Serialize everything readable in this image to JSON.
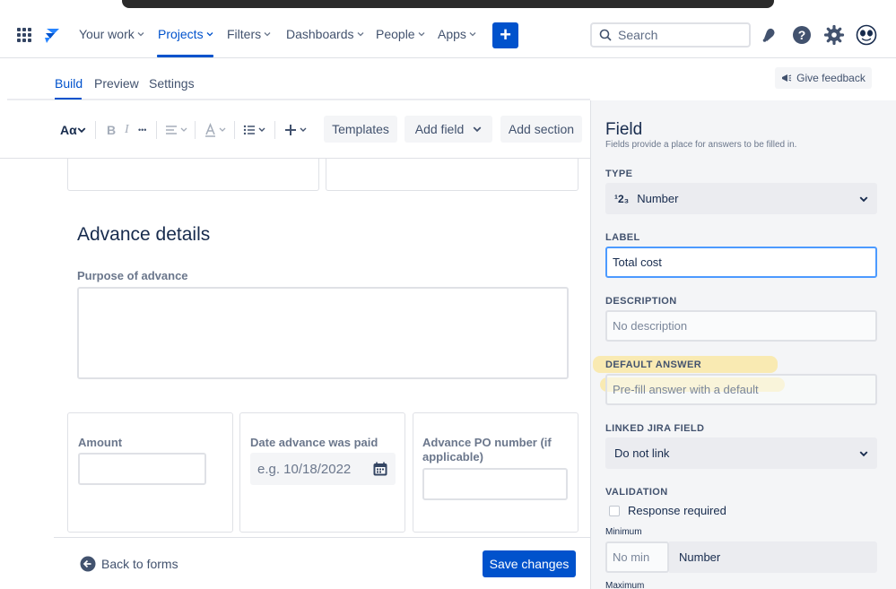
{
  "topnav": {
    "items": [
      {
        "label": "Your work"
      },
      {
        "label": "Projects"
      },
      {
        "label": "Filters"
      },
      {
        "label": "Dashboards"
      },
      {
        "label": "People"
      },
      {
        "label": "Apps"
      }
    ],
    "create_label": "+",
    "search_placeholder": "Search"
  },
  "subtabs": {
    "build": "Build",
    "preview": "Preview",
    "settings": "Settings",
    "feedback": "Give feedback"
  },
  "toolbar": {
    "text_style": "Aα",
    "bold": "B",
    "italic": "I",
    "more": "•••",
    "templates": "Templates",
    "add_field": "Add field",
    "add_section": "Add section"
  },
  "form": {
    "section_title": "Advance details",
    "purpose_label": "Purpose of advance",
    "amount_label": "Amount",
    "date_label": "Date advance was paid",
    "date_placeholder": "e.g. 10/18/2022",
    "po_label": "Advance PO number (if applicable)"
  },
  "footer": {
    "back": "Back to forms",
    "save": "Save changes"
  },
  "panel": {
    "title": "Field",
    "subtitle": "Fields provide a place for answers to be filled in.",
    "type_label": "TYPE",
    "type_icon": "¹2₃",
    "type_value": "Number",
    "label_label": "LABEL",
    "label_value": "Total cost",
    "desc_label": "DESCRIPTION",
    "desc_placeholder": "No description",
    "default_label": "DEFAULT ANSWER",
    "default_placeholder": "Pre-fill answer with a default",
    "linked_label": "LINKED JIRA FIELD",
    "linked_value": "Do not link",
    "validation_label": "VALIDATION",
    "response_required": "Response required",
    "minimum_label": "Minimum",
    "min_placeholder": "No min",
    "min_type": "Number",
    "maximum_label": "Maximum"
  },
  "colors": {
    "brand": "#0052CC",
    "highlight": "#FFDD5E",
    "focus": "#4C9AFF"
  }
}
